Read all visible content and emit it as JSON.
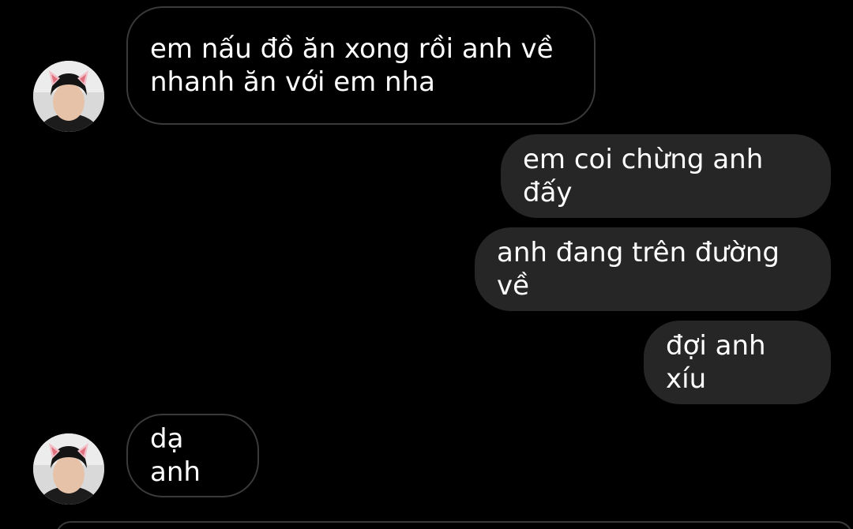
{
  "messages": [
    {
      "sender": "them",
      "text": "em nấu đồ ăn xong rồi anh về\nnhanh ăn với em nha"
    },
    {
      "sender": "me",
      "text": "em coi chừng anh đấy"
    },
    {
      "sender": "me",
      "text": "anh đang trên đường về"
    },
    {
      "sender": "me",
      "text": "đợi anh xíu"
    },
    {
      "sender": "them",
      "text": "dạ anh"
    }
  ],
  "colors": {
    "background": "#000000",
    "outgoing_bubble": "#262626",
    "incoming_border": "#3a3a3a",
    "text": "#ffffff"
  }
}
